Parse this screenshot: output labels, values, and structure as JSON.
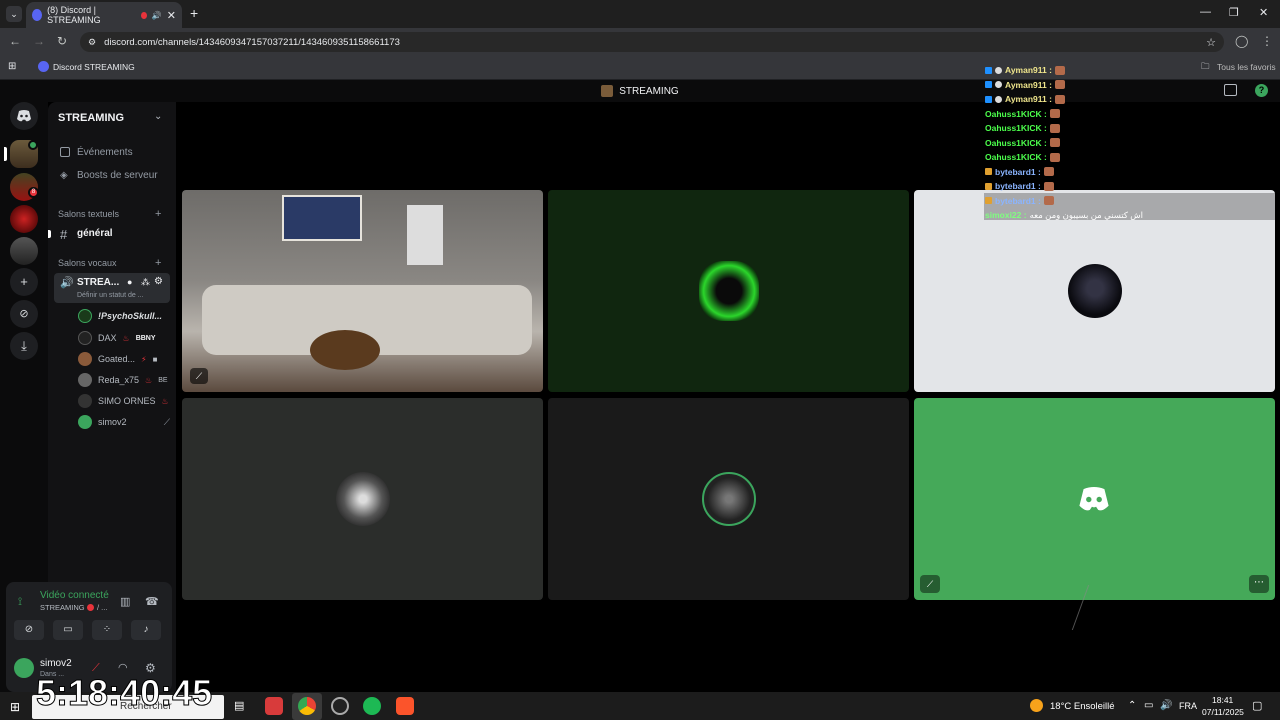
{
  "browser": {
    "tab_title": "(8) Discord | STREAMING",
    "url": "discord.com/channels/1434609347157037211/1434609351158661173",
    "bookmark": "Discord STREAMING",
    "bookmarks_all": "Tous les favoris"
  },
  "server": {
    "name": "STREAMING",
    "events": "Événements",
    "boosts": "Boosts de serveur",
    "text_category": "Salons textuels",
    "text_channel": "général",
    "voice_category": "Salons vocaux",
    "voice_channel": "STREA...",
    "voice_status": "Définir un statut de ...",
    "voice_users": [
      {
        "name": "!PsychoSkull...",
        "tag": ""
      },
      {
        "name": "DAX",
        "tag": "BBNY"
      },
      {
        "name": "Goated...",
        "tag": ""
      },
      {
        "name": "Reda_x75",
        "tag": "BE"
      },
      {
        "name": "SIMO ORNES",
        "tag": ""
      },
      {
        "name": "simov2",
        "tag": ""
      }
    ]
  },
  "topbar": {
    "channel": "STREAMING"
  },
  "panel": {
    "connected": "Vidéo connecté",
    "channel": "STREAMING",
    "separator": "/ ...",
    "username": "simov2",
    "status": "Dans ..."
  },
  "chat": [
    {
      "user": "Ayman911 :",
      "color": "#f0e68c",
      "text": ""
    },
    {
      "user": "Ayman911 :",
      "color": "#f0e68c",
      "text": ""
    },
    {
      "user": "Ayman911 :",
      "color": "#f0e68c",
      "text": ""
    },
    {
      "user": "Oahuss1KICK :",
      "color": "#4cff4c",
      "text": ""
    },
    {
      "user": "Oahuss1KICK :",
      "color": "#4cff4c",
      "text": ""
    },
    {
      "user": "Oahuss1KICK :",
      "color": "#4cff4c",
      "text": ""
    },
    {
      "user": "Oahuss1KICK :",
      "color": "#4cff4c",
      "text": ""
    },
    {
      "user": "bytebard1 :",
      "color": "#8ab4ff",
      "text": ""
    },
    {
      "user": "bytebard1 :",
      "color": "#8ab4ff",
      "text": ""
    },
    {
      "user": "bytebard1 :",
      "color": "#8ab4ff",
      "text": ""
    },
    {
      "user": "simoxi22 :",
      "color": "#7fff7f",
      "text": "اش كتسني من بسيبون ومن معه"
    }
  ],
  "taskbar": {
    "timer": "5:18:40:45",
    "search": "Rechercher",
    "weather": "18°C  Ensoleillé",
    "lang": "FRA",
    "time": "18:41",
    "date": "07/11/2025"
  },
  "colors": {
    "discord_green": "#3ba55d",
    "blurple": "#5865f2",
    "dark": "#121214"
  }
}
